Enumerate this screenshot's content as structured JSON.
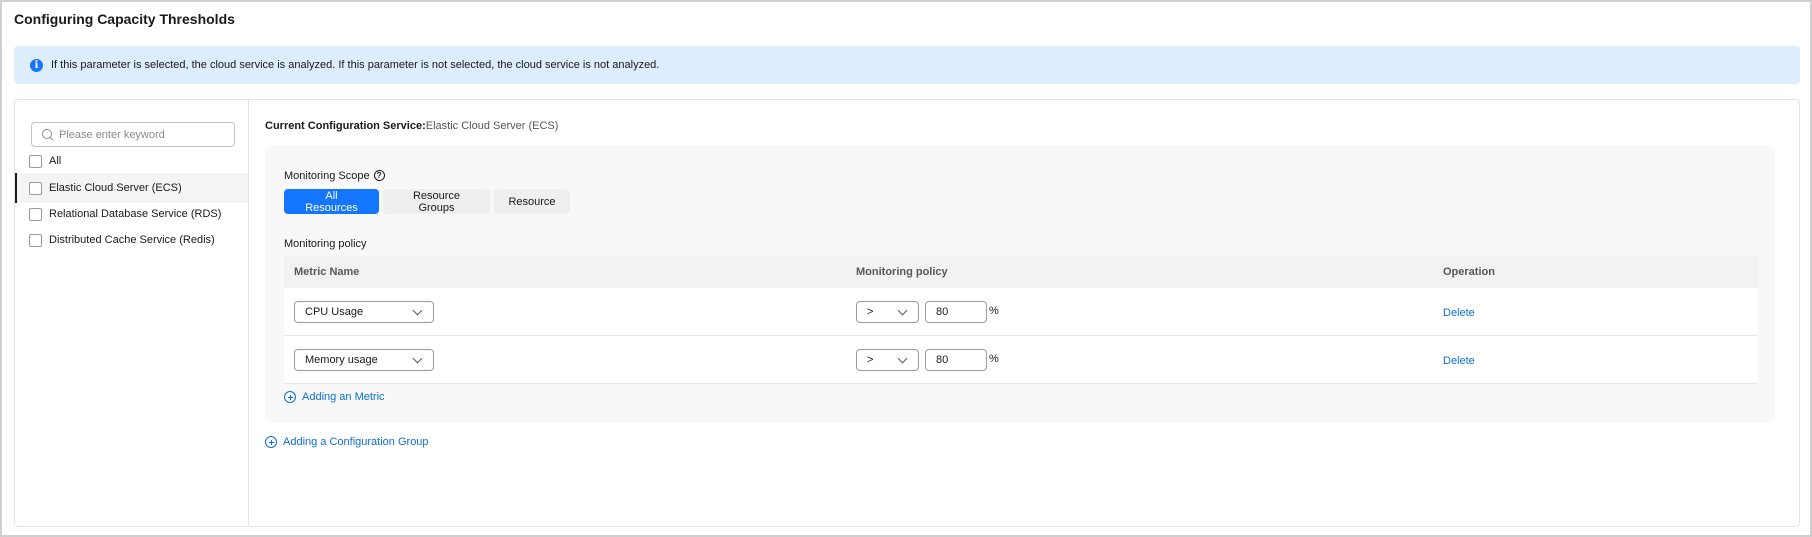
{
  "page": {
    "title": "Configuring Capacity Thresholds"
  },
  "info": {
    "text": "If this parameter is selected, the cloud service is analyzed. If this parameter is not selected, the cloud service is not analyzed."
  },
  "sidebar": {
    "search_placeholder": "Please enter keyword",
    "items": [
      {
        "label": "All"
      },
      {
        "label": "Elastic Cloud Server (ECS)"
      },
      {
        "label": "Relational Database Service (RDS)"
      },
      {
        "label": "Distributed Cache Service (Redis)"
      }
    ]
  },
  "config": {
    "current_label": "Current Configuration Service:",
    "current_value": "Elastic Cloud Server (ECS)",
    "scope_label": "Monitoring Scope",
    "scope_tabs": [
      {
        "label": "All Resources"
      },
      {
        "label": "Resource Groups"
      },
      {
        "label": "Resource"
      }
    ],
    "policy_label": "Monitoring policy",
    "columns": {
      "metric": "Metric Name",
      "policy": "Monitoring policy",
      "operation": "Operation"
    },
    "rows": [
      {
        "metric": "CPU Usage",
        "operator": ">",
        "value": "80",
        "unit": "%",
        "action": "Delete"
      },
      {
        "metric": "Memory usage",
        "operator": ">",
        "value": "80",
        "unit": "%",
        "action": "Delete"
      }
    ],
    "add_metric": "Adding an Metric",
    "add_group": "Adding a Configuration Group"
  },
  "colors": {
    "accent": "#1476ff",
    "info_bg": "#deedfd",
    "link": "#0d6fd1"
  }
}
